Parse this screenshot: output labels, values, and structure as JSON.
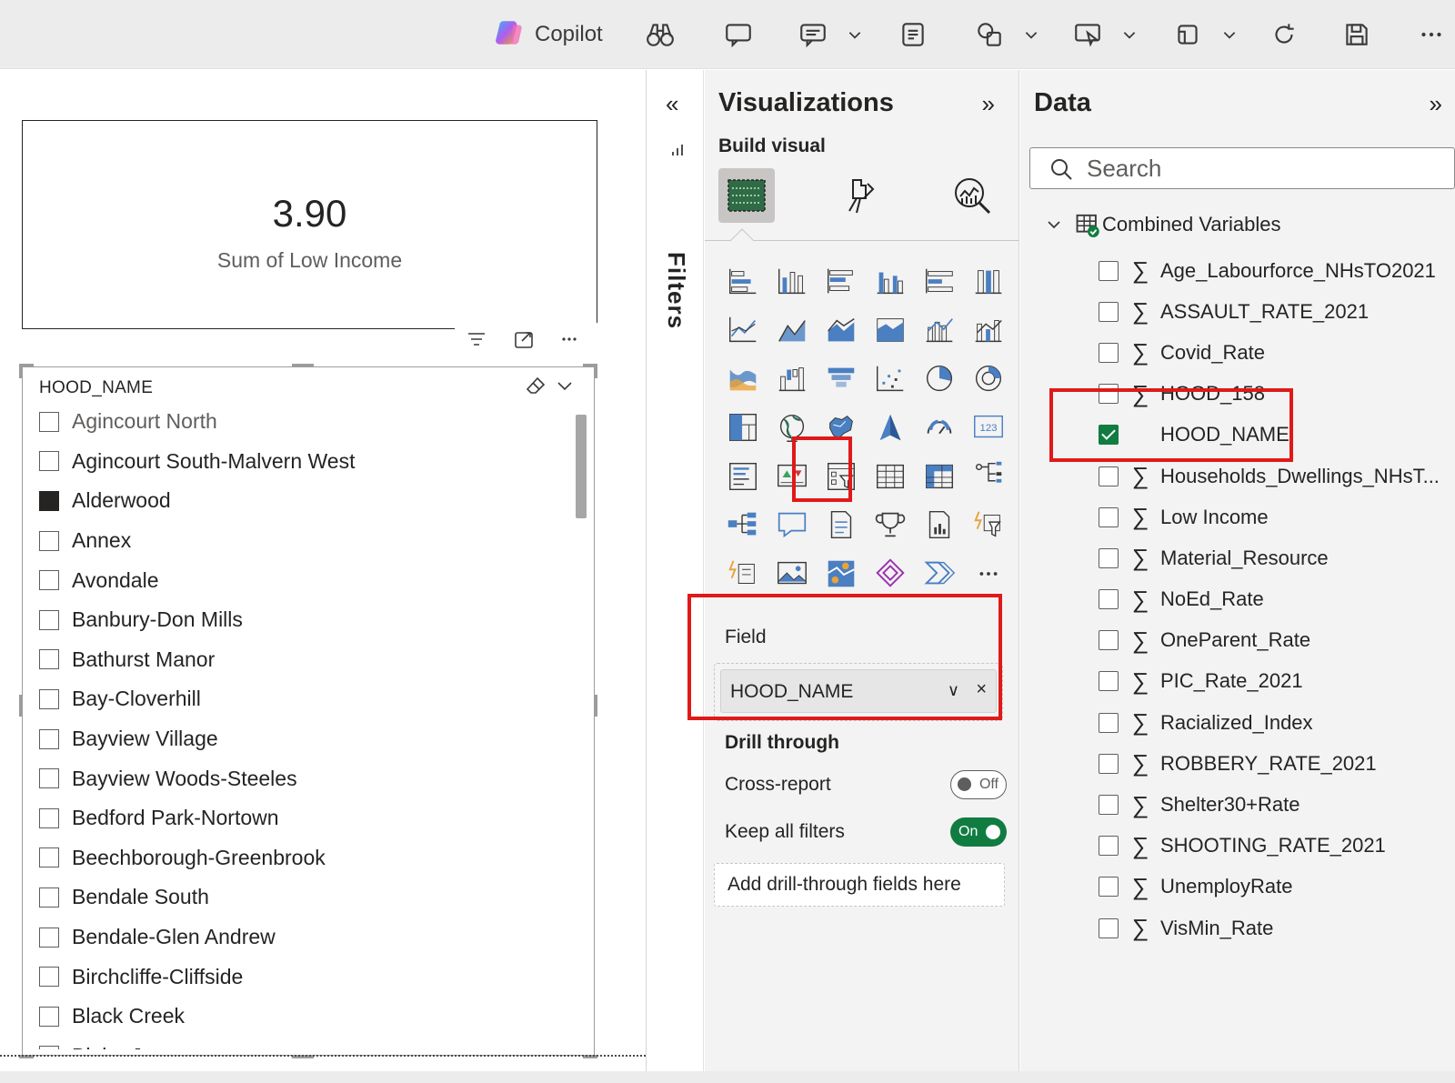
{
  "ribbon": {
    "copilot_label": "Copilot",
    "icons": [
      "copilot-icon",
      "binoculars-icon",
      "comment-icon",
      "slide-icon",
      "chevron-down-icon",
      "notes-icon",
      "shapes-icon",
      "chevron-down-icon",
      "present-icon",
      "chevron-down-icon",
      "view-icon",
      "chevron-down-icon",
      "refresh-icon",
      "save-icon",
      "more-icon"
    ]
  },
  "card": {
    "value": "3.90",
    "label": "Sum of Low Income"
  },
  "slicer": {
    "title": "HOOD_NAME",
    "items": [
      {
        "label": "Agincourt North",
        "checked": false
      },
      {
        "label": "Agincourt South-Malvern West",
        "checked": false
      },
      {
        "label": "Alderwood",
        "checked": true
      },
      {
        "label": "Annex",
        "checked": false
      },
      {
        "label": "Avondale",
        "checked": false
      },
      {
        "label": "Banbury-Don Mills",
        "checked": false
      },
      {
        "label": "Bathurst Manor",
        "checked": false
      },
      {
        "label": "Bay-Cloverhill",
        "checked": false
      },
      {
        "label": "Bayview Village",
        "checked": false
      },
      {
        "label": "Bayview Woods-Steeles",
        "checked": false
      },
      {
        "label": "Bedford Park-Nortown",
        "checked": false
      },
      {
        "label": "Beechborough-Greenbrook",
        "checked": false
      },
      {
        "label": "Bendale South",
        "checked": false
      },
      {
        "label": "Bendale-Glen Andrew",
        "checked": false
      },
      {
        "label": "Birchcliffe-Cliffside",
        "checked": false
      },
      {
        "label": "Black Creek",
        "checked": false
      },
      {
        "label": "Blake-Jones",
        "checked": false
      }
    ]
  },
  "filters": {
    "label": "Filters",
    "collapse": "«"
  },
  "visualizations": {
    "title": "Visualizations",
    "expand": "»",
    "build_label": "Build visual",
    "field_label": "Field",
    "field_value": "HOOD_NAME",
    "drill_title": "Drill through",
    "cross_report_label": "Cross-report",
    "cross_report_state": "Off",
    "keep_filters_label": "Keep all filters",
    "keep_filters_state": "On",
    "drill_placeholder": "Add drill-through fields here",
    "more": "···"
  },
  "data": {
    "title": "Data",
    "expand": "»",
    "search_placeholder": "Search",
    "table_name": "Combined Variables",
    "fields": [
      {
        "name": "Age_Labourforce_NHsTO2021",
        "checked": false,
        "sigma": true
      },
      {
        "name": "ASSAULT_RATE_2021",
        "checked": false,
        "sigma": true
      },
      {
        "name": "Covid_Rate",
        "checked": false,
        "sigma": true
      },
      {
        "name": "HOOD_158",
        "checked": false,
        "sigma": true
      },
      {
        "name": "HOOD_NAME",
        "checked": true,
        "sigma": false
      },
      {
        "name": "Households_Dwellings_NHsT...",
        "checked": false,
        "sigma": true
      },
      {
        "name": "Low Income",
        "checked": false,
        "sigma": true
      },
      {
        "name": "Material_Resource",
        "checked": false,
        "sigma": true
      },
      {
        "name": "NoEd_Rate",
        "checked": false,
        "sigma": true
      },
      {
        "name": "OneParent_Rate",
        "checked": false,
        "sigma": true
      },
      {
        "name": "PIC_Rate_2021",
        "checked": false,
        "sigma": true
      },
      {
        "name": "Racialized_Index",
        "checked": false,
        "sigma": true
      },
      {
        "name": "ROBBERY_RATE_2021",
        "checked": false,
        "sigma": true
      },
      {
        "name": "Shelter30+Rate",
        "checked": false,
        "sigma": true
      },
      {
        "name": "SHOOTING_RATE_2021",
        "checked": false,
        "sigma": true
      },
      {
        "name": "UnemployRate",
        "checked": false,
        "sigma": true
      },
      {
        "name": "VisMin_Rate",
        "checked": false,
        "sigma": true
      }
    ]
  },
  "colors": {
    "highlight": "#e01919",
    "accent_green": "#107c41",
    "pane_bg": "#f3f3f3"
  }
}
